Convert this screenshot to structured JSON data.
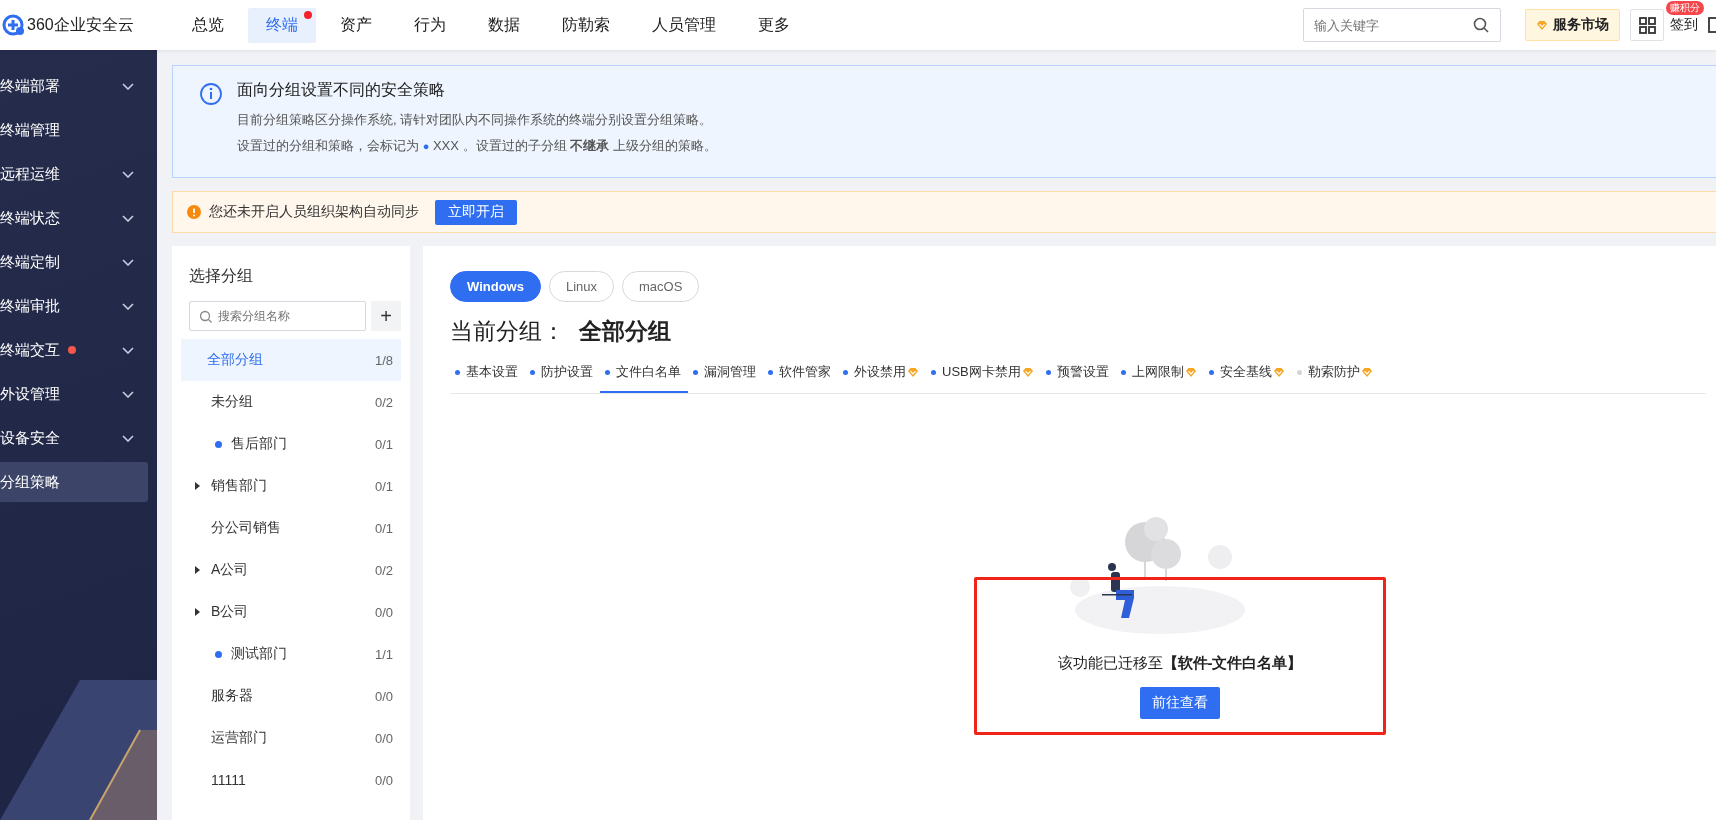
{
  "top_bar": {
    "logo_text": "360企业安全云",
    "nav": [
      {
        "label": "总览",
        "selected": false,
        "dot": false
      },
      {
        "label": "终端",
        "selected": true,
        "dot": true
      },
      {
        "label": "资产",
        "selected": false,
        "dot": false
      },
      {
        "label": "行为",
        "selected": false,
        "dot": false
      },
      {
        "label": "数据",
        "selected": false,
        "dot": false
      },
      {
        "label": "防勒索",
        "selected": false,
        "dot": false
      },
      {
        "label": "人员管理",
        "selected": false,
        "dot": false
      },
      {
        "label": "更多",
        "selected": false,
        "dot": false
      }
    ],
    "search": {
      "placeholder": "输入关键字"
    },
    "market_button": "服务市场",
    "checkin": {
      "label": "签到",
      "badge": "赚积分"
    }
  },
  "sidebar": {
    "items": [
      {
        "label": "终端部署",
        "expandable": true,
        "dot": false,
        "selected": false
      },
      {
        "label": "终端管理",
        "expandable": false,
        "dot": false,
        "selected": false
      },
      {
        "label": "远程运维",
        "expandable": true,
        "dot": false,
        "selected": false
      },
      {
        "label": "终端状态",
        "expandable": true,
        "dot": false,
        "selected": false
      },
      {
        "label": "终端定制",
        "expandable": true,
        "dot": false,
        "selected": false
      },
      {
        "label": "终端审批",
        "expandable": true,
        "dot": false,
        "selected": false
      },
      {
        "label": "终端交互",
        "expandable": true,
        "dot": true,
        "selected": false
      },
      {
        "label": "外设管理",
        "expandable": true,
        "dot": false,
        "selected": false
      },
      {
        "label": "设备安全",
        "expandable": true,
        "dot": false,
        "selected": false
      },
      {
        "label": "分组策略",
        "expandable": false,
        "dot": false,
        "selected": true
      }
    ]
  },
  "info_banner": {
    "title": "面向分组设置不同的安全策略",
    "line_1": "目前分组策略区分操作系统, 请针对团队内不同操作系统的终端分别设置分组策略。",
    "line_2": {
      "before": "设置过的分组和策略，会标记为",
      "marker": "●",
      "after": "XXX 。设置过的子分组 **不继承** 上级分组的策略。"
    }
  },
  "warning_banner": {
    "text": "您还未开启人员组织架构自动同步",
    "button": "立即开启"
  },
  "group_panel": {
    "title": "选择分组",
    "search": {
      "placeholder": "搜索分组名称"
    },
    "add_button": "+",
    "tree": [
      {
        "name": "全部分组",
        "count": "1/8",
        "selected": true,
        "configured": false,
        "collapsed": false,
        "children": [
          {
            "name": "未分组",
            "count": "0/2",
            "selected": false,
            "configured": false,
            "collapsed": false
          },
          {
            "name": "售后部门",
            "count": "0/1",
            "selected": false,
            "configured": true,
            "collapsed": false
          },
          {
            "name": "销售部门",
            "count": "0/1",
            "selected": false,
            "configured": false,
            "collapsed": true
          },
          {
            "name": "分公司销售",
            "count": "0/1",
            "selected": false,
            "configured": false,
            "collapsed": false
          },
          {
            "name": "A公司",
            "count": "0/2",
            "selected": false,
            "configured": false,
            "collapsed": true
          },
          {
            "name": "B公司",
            "count": "0/0",
            "selected": false,
            "configured": false,
            "collapsed": true
          },
          {
            "name": "测试部门",
            "count": "1/1",
            "selected": false,
            "configured": true,
            "collapsed": false
          },
          {
            "name": "服务器",
            "count": "0/0",
            "selected": false,
            "configured": false,
            "collapsed": false
          },
          {
            "name": "运营部门",
            "count": "0/0",
            "selected": false,
            "configured": false,
            "collapsed": false
          },
          {
            "name": "11111",
            "count": "0/0",
            "selected": false,
            "configured": false,
            "collapsed": false
          }
        ]
      }
    ]
  },
  "policy_panel": {
    "os_tabs": [
      {
        "label": "Windows",
        "selected": true
      },
      {
        "label": "Linux",
        "selected": false
      },
      {
        "label": "macOS",
        "selected": false
      }
    ],
    "current_group_label": "当前分组：",
    "current_group": "全部分组",
    "policy_tabs": [
      {
        "label": "基本设置",
        "selected": false,
        "configured": true,
        "premium": false
      },
      {
        "label": "防护设置",
        "selected": false,
        "configured": true,
        "premium": false
      },
      {
        "label": "文件白名单",
        "selected": true,
        "configured": true,
        "premium": false
      },
      {
        "label": "漏洞管理",
        "selected": false,
        "configured": true,
        "premium": false
      },
      {
        "label": "软件管家",
        "selected": false,
        "configured": true,
        "premium": false
      },
      {
        "label": "外设禁用",
        "selected": false,
        "configured": true,
        "premium": true
      },
      {
        "label": "USB网卡禁用",
        "selected": false,
        "configured": true,
        "premium": true
      },
      {
        "label": "预警设置",
        "selected": false,
        "configured": true,
        "premium": false
      },
      {
        "label": "上网限制",
        "selected": false,
        "configured": true,
        "premium": true
      },
      {
        "label": "安全基线",
        "selected": false,
        "configured": true,
        "premium": true
      },
      {
        "label": "勒索防护",
        "selected": false,
        "configured": false,
        "premium": true
      }
    ],
    "empty_state": {
      "message": "该功能已迁移至**【软件-文件白名单】**",
      "button": "前往查看",
      "highlighted": true
    }
  }
}
